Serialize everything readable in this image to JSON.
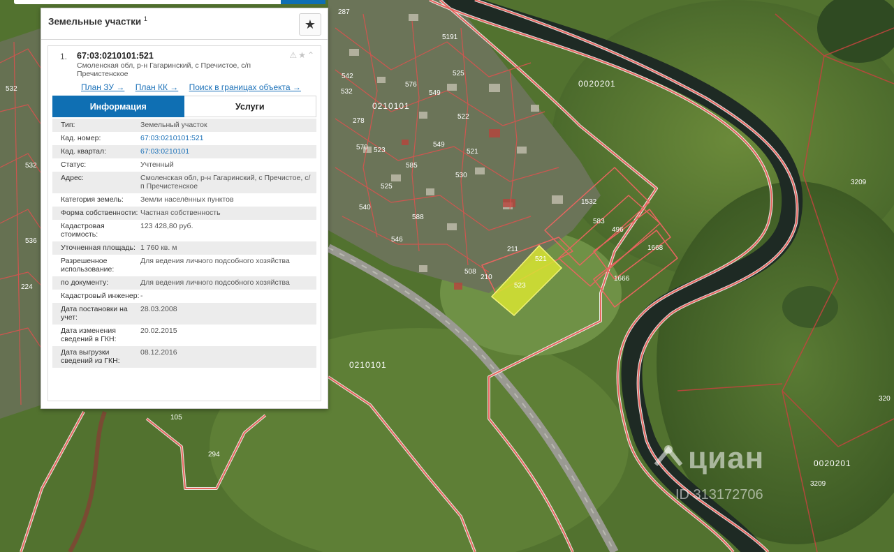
{
  "panel": {
    "title": "Земельные участки",
    "title_count": "1",
    "star_icon": "★",
    "item_index": "1.",
    "cad_number": "67:03:0210101:521",
    "address": "Смоленская обл, р-н Гагаринский, с Пречистое, с/п Пречистенское",
    "header_icons": "⚠★⌃",
    "links": [
      "План ЗУ →",
      "План КК →",
      "Поиск в границах объекта →"
    ],
    "tabs": [
      "Информация",
      "Услуги"
    ],
    "properties": [
      {
        "key": "Тип:",
        "value": "Земельный участок"
      },
      {
        "key": "Кад. номер:",
        "value": "67:03:0210101:521",
        "link": true
      },
      {
        "key": "Кад. квартал:",
        "value": "67:03:0210101",
        "link": true
      },
      {
        "key": "Статус:",
        "value": "Учтенный"
      },
      {
        "key": "Адрес:",
        "value": "Смоленская обл, р-н Гагаринский, с Пречистое, с/п Пречистенское"
      },
      {
        "key": "Категория земель:",
        "value": "Земли населённых пунктов"
      },
      {
        "key": "Форма собственности:",
        "value": "Частная собственность"
      },
      {
        "key": "Кадастровая стоимость:",
        "value": "123 428,80 руб."
      },
      {
        "key": "Уточненная площадь:",
        "value": "1 760 кв. м"
      },
      {
        "key": "Разрешенное использование:",
        "value": "Для ведения личного подсобного хозяйства"
      },
      {
        "key": "по документу:",
        "value": "Для ведения личного подсобного хозяйства"
      },
      {
        "key": "Кадастровый инженер:",
        "value": "-"
      },
      {
        "key": "Дата постановки на учет:",
        "value": "28.03.2008"
      },
      {
        "key": "Дата изменения сведений в ГКН:",
        "value": "20.02.2015"
      },
      {
        "key": "Дата выгрузки сведений из ГКН:",
        "value": "08.12.2016"
      }
    ]
  },
  "map": {
    "block_labels": [
      "0210101",
      "0020201",
      "0210101",
      "0020201"
    ],
    "edge_labels": [
      "3209",
      "3209",
      "320"
    ],
    "parcel_labels": [
      "521",
      "523",
      "1532",
      "583",
      "496",
      "1668",
      "1666",
      "211",
      "508",
      "210",
      "105",
      "294",
      "5191",
      "525",
      "576",
      "549",
      "542",
      "532",
      "522",
      "530",
      "540",
      "523",
      "532",
      "536",
      "532",
      "224",
      "278",
      "570",
      "546",
      "549",
      "521",
      "585",
      "525",
      "588",
      "287"
    ],
    "colors": {
      "boundary": "#e8655f",
      "boundary_glow": "#ffffff",
      "selected_fill": "#d8e432",
      "river": "#1e2a24",
      "road": "#9a9a92"
    }
  },
  "watermark": {
    "brand": "циан",
    "id_text": "ID 313172706"
  }
}
